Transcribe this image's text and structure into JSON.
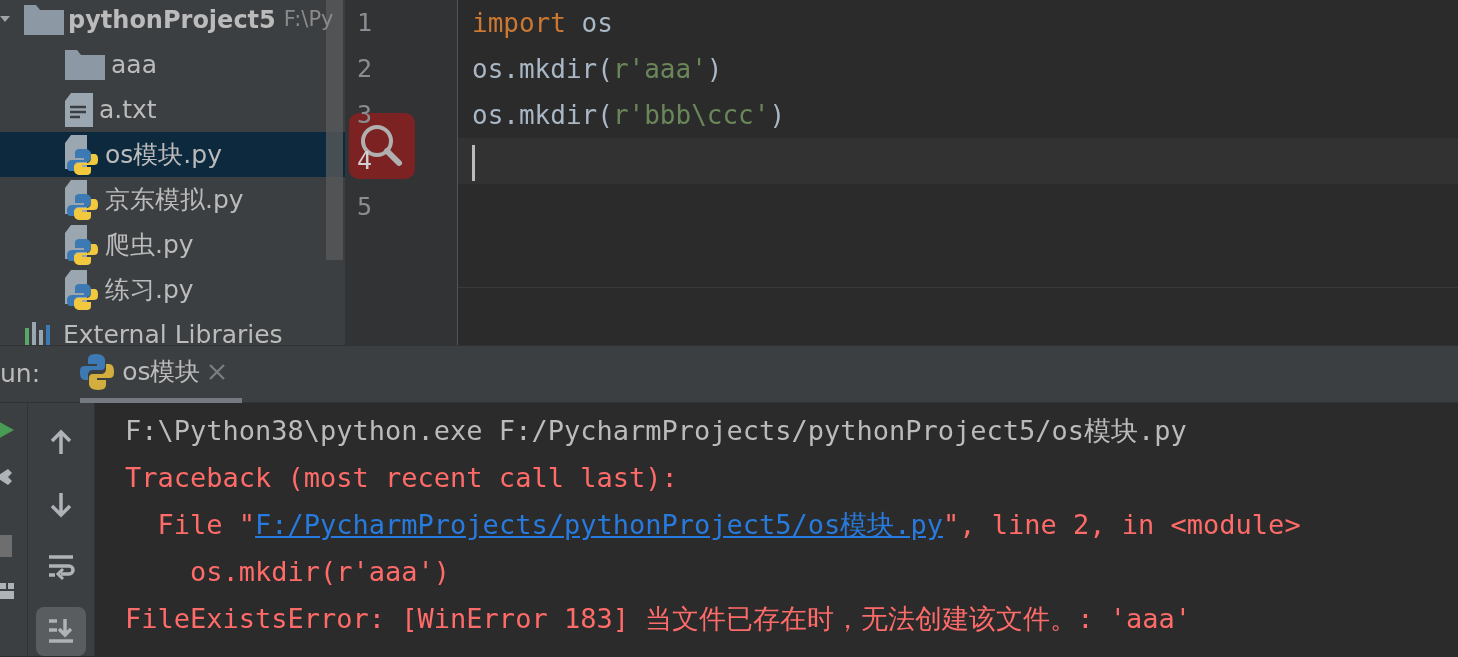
{
  "project_tree": {
    "label": "pythonProject5",
    "path": "F:\\Py",
    "expanded": true,
    "children": [
      {
        "label": "aaa",
        "kind": "folder",
        "selected": false
      },
      {
        "label": "a.txt",
        "kind": "text",
        "selected": false
      },
      {
        "label": "os模块.py",
        "kind": "python",
        "selected": true
      },
      {
        "label": "京东模拟.py",
        "kind": "python",
        "selected": false
      },
      {
        "label": "爬虫.py",
        "kind": "python",
        "selected": false
      },
      {
        "label": "练习.py",
        "kind": "python",
        "selected": false
      }
    ]
  },
  "external_libraries": {
    "label": "External Libraries"
  },
  "editor": {
    "lines": [
      {
        "number": "1",
        "current": false,
        "tokens": [
          {
            "kind": "keyword",
            "text": "import"
          },
          {
            "kind": "plain",
            "text": " os"
          }
        ]
      },
      {
        "number": "2",
        "current": false,
        "tokens": [
          {
            "kind": "plain",
            "text": "os.mkdir("
          },
          {
            "kind": "string",
            "text": "r'aaa'"
          },
          {
            "kind": "plain",
            "text": ")"
          }
        ]
      },
      {
        "number": "3",
        "current": false,
        "tokens": [
          {
            "kind": "plain",
            "text": "os.mkdir("
          },
          {
            "kind": "string",
            "text": "r'bbb\\ccc'"
          },
          {
            "kind": "plain",
            "text": ")"
          }
        ]
      },
      {
        "number": "4",
        "current": true
      },
      {
        "number": "5",
        "current": false
      }
    ]
  },
  "run_panel": {
    "label": "un:",
    "tabs": [
      {
        "label": "os模块",
        "selected": true
      }
    ],
    "toolbar": [
      {
        "kind": "up",
        "on": false
      },
      {
        "kind": "down",
        "on": false
      },
      {
        "kind": "wrap",
        "on": false
      },
      {
        "kind": "scroll_end",
        "on": true
      }
    ],
    "console": [
      [
        {
          "kind": "info",
          "text": "F:\\Python38\\python.exe F:/PycharmProjects/pythonProject5/os模块.py"
        }
      ],
      [
        {
          "kind": "error",
          "text": "Traceback (most recent call last):"
        }
      ],
      [
        {
          "kind": "error",
          "text": "  File \""
        },
        {
          "kind": "link",
          "text": "F:/PycharmProjects/pythonProject5/os模块.py"
        },
        {
          "kind": "error",
          "text": "\", line 2, in <module>"
        }
      ],
      [
        {
          "kind": "error",
          "text": "    os.mkdir(r'aaa')"
        }
      ],
      [
        {
          "kind": "error",
          "text": "FileExistsError: [WinError 183] 当文件已存在时，无法创建该文件。: 'aaa'"
        }
      ]
    ]
  }
}
